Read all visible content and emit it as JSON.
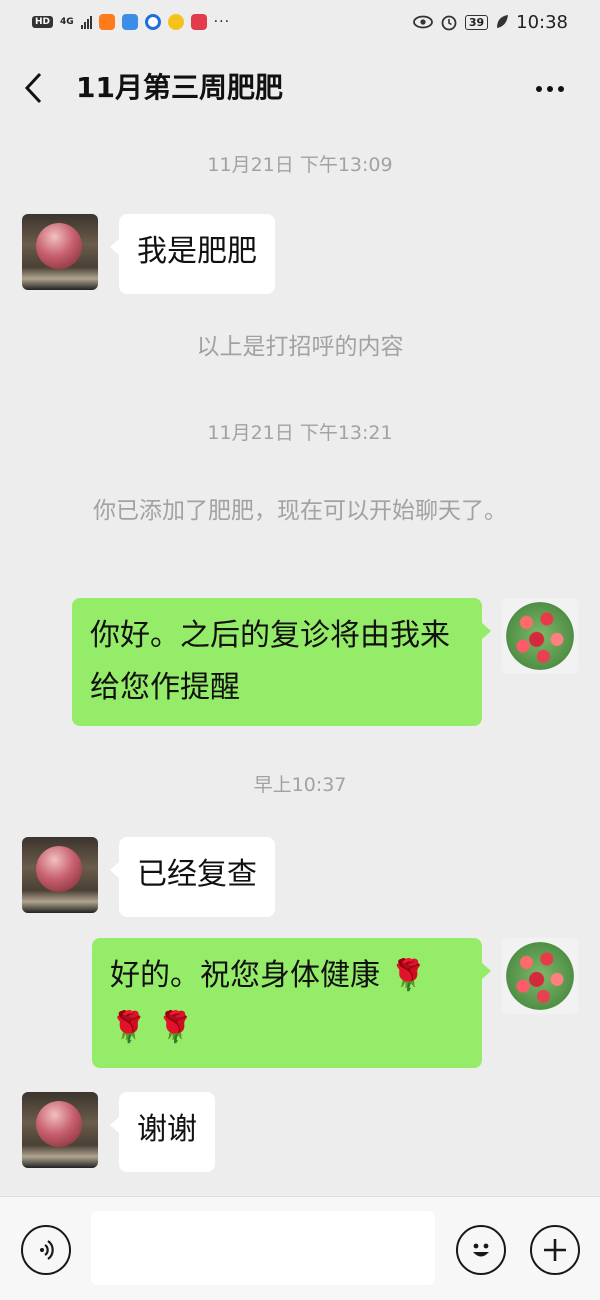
{
  "status_bar": {
    "hd": "HD",
    "network": "4G",
    "dots": "···",
    "battery": "39",
    "time": "10:38"
  },
  "header": {
    "title": "11月第三周肥肥"
  },
  "messages": {
    "ts1": "11月21日 下午13:09",
    "m1": "我是肥肥",
    "sys1": "以上是打招呼的内容",
    "ts2": "11月21日 下午13:21",
    "sys2": "你已添加了肥肥，现在可以开始聊天了。",
    "m2": "你好。之后的复诊将由我来给您作提醒",
    "ts3": "早上10:37",
    "m3": "已经复查",
    "m4": "好的。祝您身体健康",
    "m4_emoji": "🌹 🌹 🌹",
    "m5": "谢谢"
  },
  "input": {
    "value": "",
    "placeholder": ""
  },
  "colors": {
    "background": "#ededed",
    "outgoing_bubble": "#95ec69",
    "incoming_bubble": "#ffffff"
  }
}
